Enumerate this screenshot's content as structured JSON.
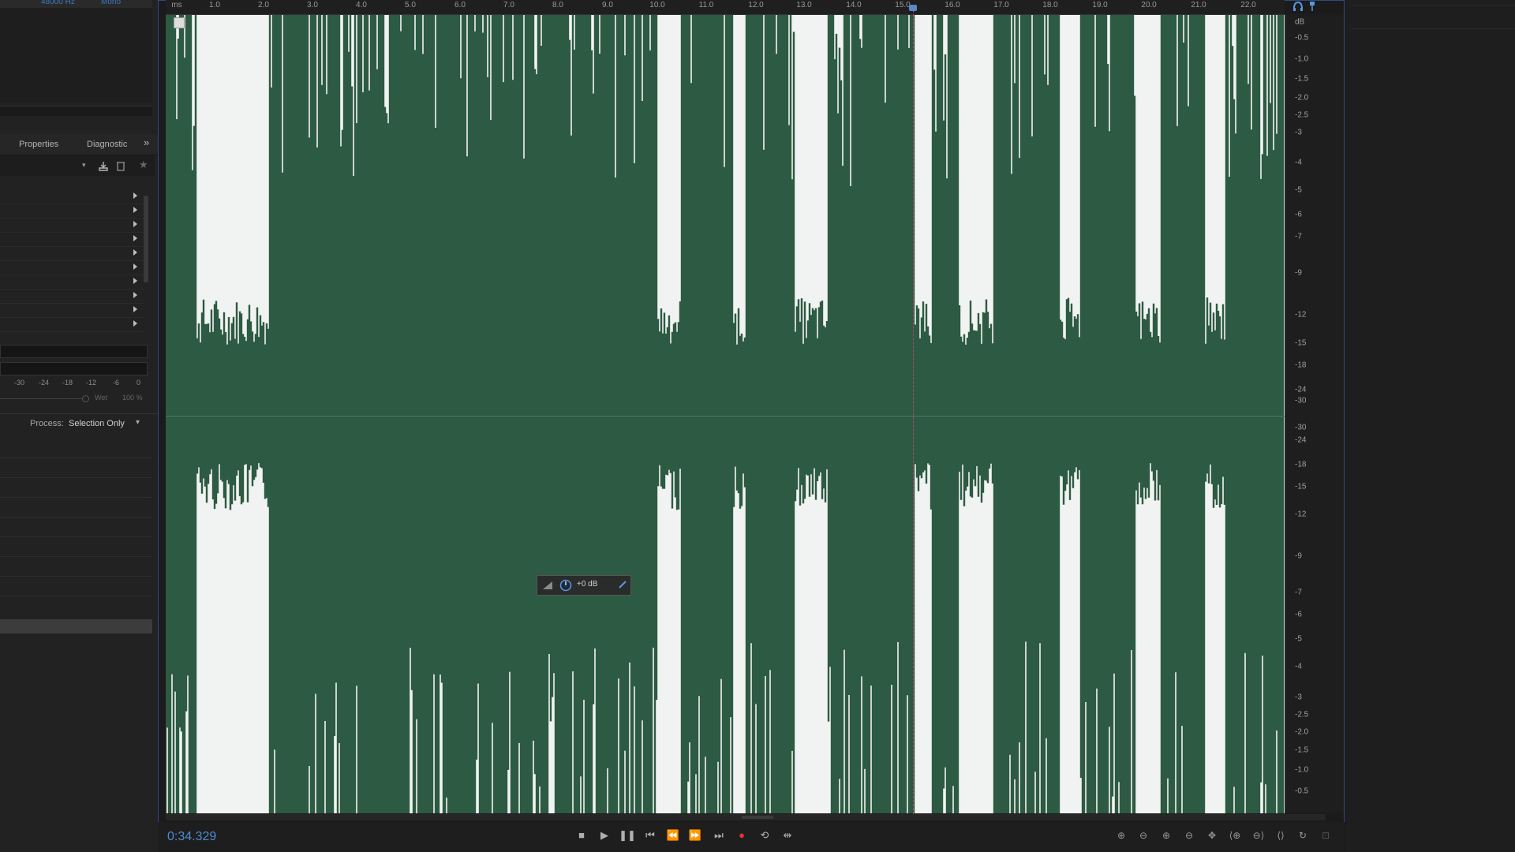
{
  "left_panel": {
    "top_info": {
      "sample_rate": "48000 Hz",
      "channels": "Mono"
    },
    "tabs": [
      {
        "label": "Properties"
      },
      {
        "label": "Diagnostic"
      }
    ],
    "meter_labels": [
      "-30",
      "-24",
      "-18",
      "-12",
      "-6",
      "0"
    ],
    "wet_label": "Wet",
    "wet_value": "100 %",
    "process_label": "Process:",
    "process_value": "Selection Only"
  },
  "ruler": {
    "unit": "ms",
    "labels": [
      "1.0",
      "2.0",
      "3.0",
      "4.0",
      "5.0",
      "6.0",
      "7.0",
      "8.0",
      "9.0",
      "10.0",
      "11.0",
      "12.0",
      "13.0",
      "14.0",
      "15.0",
      "16.0",
      "17.0",
      "18.0",
      "19.0",
      "20.0",
      "21.0",
      "22.0"
    ]
  },
  "db_scale": {
    "unit": "dB",
    "top_labels": [
      "-0.5",
      "-1.0",
      "-1.5",
      "-2.0",
      "-2.5",
      "-3",
      "-4",
      "-5",
      "-6",
      "-7",
      "-9",
      "-12",
      "-15",
      "-18",
      "-24",
      "-30"
    ],
    "bottom_labels": [
      "-30",
      "-24",
      "-18",
      "-15",
      "-12",
      "-9",
      "-7",
      "-6",
      "-5",
      "-4",
      "-3",
      "-2.5",
      "-2.0",
      "-1.5",
      "-1.0",
      "-0.5"
    ]
  },
  "hud": {
    "gain": "+0 dB"
  },
  "transport": {
    "current_time": "0:34.329"
  },
  "colors": {
    "waveform": "#2d5a42",
    "background": "#f1f3f2",
    "accent": "#4b8bd6"
  }
}
